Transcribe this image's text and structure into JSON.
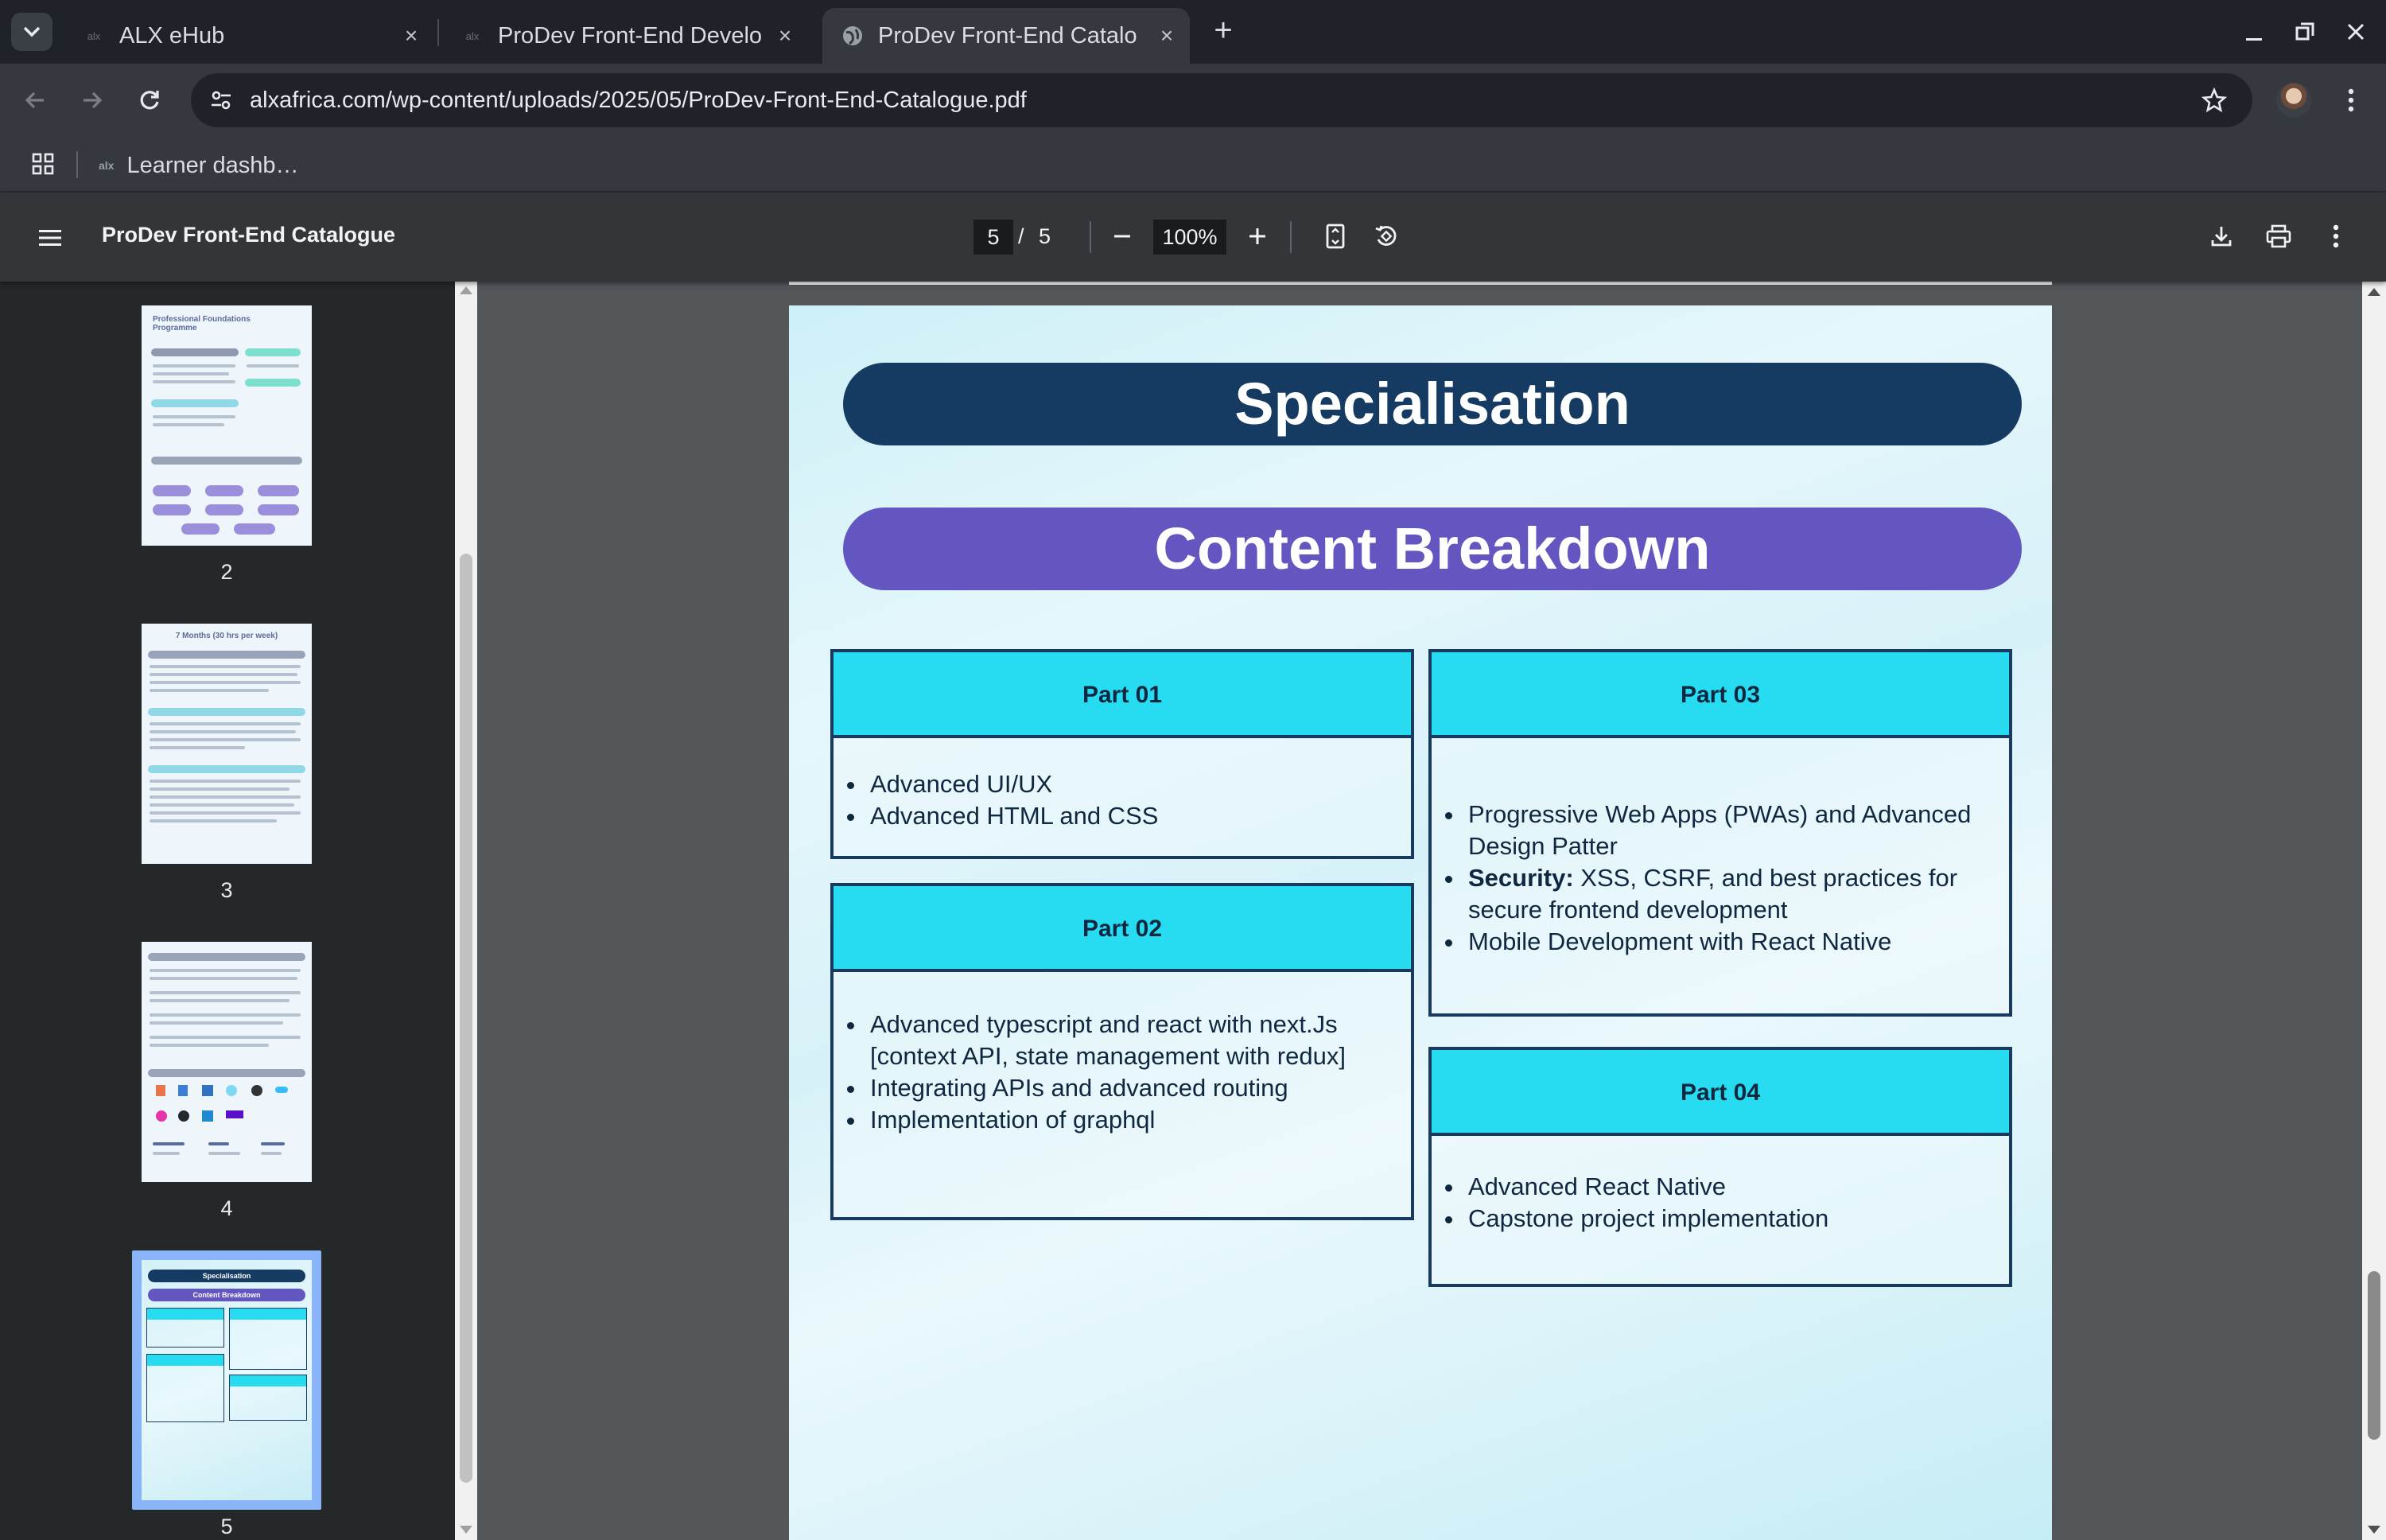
{
  "browser": {
    "tabs": [
      {
        "title": "ALX eHub",
        "favicon": "alx-logo-icon",
        "active": false
      },
      {
        "title": "ProDev Front-End Develo",
        "favicon": "alx-logo-icon",
        "active": false
      },
      {
        "title": "ProDev Front-End Catalo",
        "favicon": "globe-icon",
        "active": true
      }
    ],
    "url": "alxafrica.com/wp-content/uploads/2025/05/ProDev-Front-End-Catalogue.pdf",
    "bookmarks": [
      {
        "label": "Learner dashb…",
        "favicon": "alx"
      }
    ]
  },
  "pdf_viewer": {
    "title": "ProDev Front-End Catalogue",
    "current_page": "5",
    "page_separator": "/",
    "total_pages": "5",
    "zoom": "100%",
    "thumbnails": [
      {
        "number": "2",
        "title": "Professional Foundations Programme"
      },
      {
        "number": "3",
        "title": "7 Months (30 hrs per week)"
      },
      {
        "number": "4",
        "title": ""
      },
      {
        "number": "5",
        "title": "Specialisation",
        "subtitle": "Content Breakdown",
        "selected": true
      }
    ]
  },
  "document": {
    "heading": "Specialisation",
    "subheading": "Content Breakdown",
    "parts": [
      {
        "title": "Part 01",
        "items": [
          {
            "text": "Advanced UI/UX"
          },
          {
            "text": "Advanced HTML and CSS"
          }
        ]
      },
      {
        "title": "Part 02",
        "items": [
          {
            "text": "Advanced typescript and react with next.Js [context API, state management with redux]"
          },
          {
            "text": "Integrating APIs and advanced routing"
          },
          {
            "text": "Implementation of graphql"
          }
        ]
      },
      {
        "title": "Part 03",
        "items": [
          {
            "text": "Progressive Web Apps (PWAs) and Advanced Design Patter"
          },
          {
            "bold": "Security:",
            "text": " XSS, CSRF, and best practices for secure frontend development"
          },
          {
            "text": "Mobile Development with React Native"
          }
        ]
      },
      {
        "title": "Part 04",
        "items": [
          {
            "text": "Advanced React Native"
          },
          {
            "text": "Capstone project implementation"
          }
        ]
      }
    ]
  },
  "colors": {
    "spec_banner": "#153b63",
    "content_banner": "#6356c0",
    "part_header": "#27dcf0",
    "part_border": "#173a5e"
  }
}
